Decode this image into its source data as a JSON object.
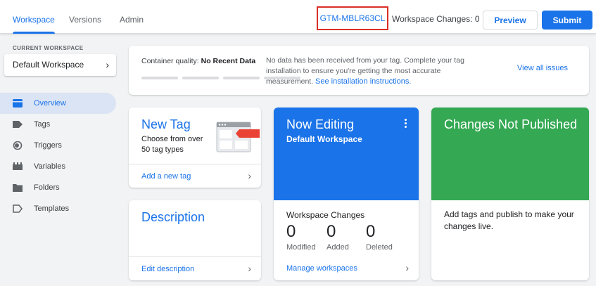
{
  "topbar": {
    "tabs": [
      {
        "label": "Workspace",
        "active": true
      },
      {
        "label": "Versions",
        "active": false
      },
      {
        "label": "Admin",
        "active": false
      }
    ],
    "container_id": "GTM-MBLR63CL",
    "workspace_changes": "Workspace Changes: 0",
    "preview_label": "Preview",
    "submit_label": "Submit"
  },
  "sidebar": {
    "current_workspace_label": "CURRENT WORKSPACE",
    "workspace_name": "Default Workspace",
    "items": [
      {
        "label": "Overview",
        "icon": "overview-icon",
        "active": true
      },
      {
        "label": "Tags",
        "icon": "tag-icon",
        "active": false
      },
      {
        "label": "Triggers",
        "icon": "trigger-icon",
        "active": false
      },
      {
        "label": "Variables",
        "icon": "variables-icon",
        "active": false
      },
      {
        "label": "Folders",
        "icon": "folder-icon",
        "active": false
      },
      {
        "label": "Templates",
        "icon": "template-icon",
        "active": false
      }
    ]
  },
  "quality": {
    "label": "Container quality:",
    "status": "No Recent Data",
    "message": "No data has been received from your tag. Complete your tag installation to ensure you're getting the most accurate measurement.",
    "instructions_link": "See installation instructions.",
    "view_issues": "View all issues"
  },
  "new_tag": {
    "title": "New Tag",
    "description": "Choose from over 50 tag types",
    "action": "Add a new tag"
  },
  "description_card": {
    "title": "Description",
    "action": "Edit description"
  },
  "now_editing": {
    "title": "Now Editing",
    "workspace": "Default Workspace",
    "changes_label": "Workspace Changes",
    "stats": [
      {
        "value": "0",
        "label": "Modified"
      },
      {
        "value": "0",
        "label": "Added"
      },
      {
        "value": "0",
        "label": "Deleted"
      }
    ],
    "action": "Manage workspaces"
  },
  "not_published": {
    "title": "Changes Not Published",
    "description": "Add tags and publish to make your changes live."
  },
  "colors": {
    "accent": "#1a73e8",
    "editing_header": "#1a73e8",
    "not_published_header": "#34a853",
    "highlight_border": "#d93025"
  }
}
